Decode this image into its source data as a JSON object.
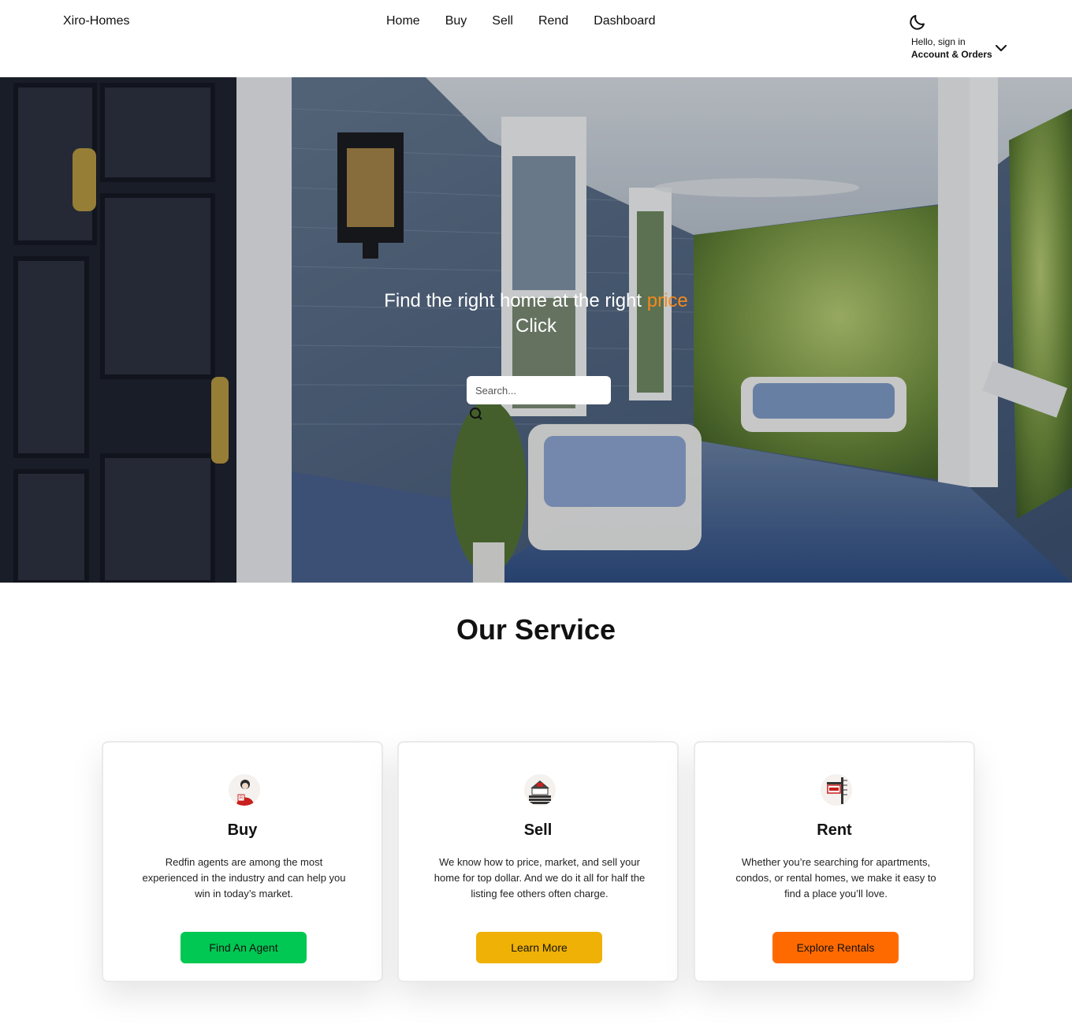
{
  "header": {
    "brand": "Xiro-Homes",
    "nav": [
      "Home",
      "Buy",
      "Sell",
      "Rend",
      "Dashboard"
    ],
    "theme_icon": "moon-icon",
    "account_greeting": "Hello, sign in",
    "account_label": "Account & Orders"
  },
  "hero": {
    "title_main": "Find the right home at the right ",
    "title_accent": "price",
    "title_line2": "Click",
    "search_placeholder": "Search...",
    "accent_color": "#f28a1c"
  },
  "service": {
    "title": "Our Service",
    "cards": [
      {
        "icon": "agent-icon",
        "title": "Buy",
        "text": "Redfin agents are among the most experienced in the industry and can help you win in today’s market.",
        "button": "Find An Agent",
        "button_color": "#00c853"
      },
      {
        "icon": "house-sale-icon",
        "title": "Sell",
        "text": "We know how to price, market, and sell your home for top dollar. And we do it all for half the listing fee others often charge.",
        "button": "Learn More",
        "button_color": "#efb106"
      },
      {
        "icon": "rent-sign-icon",
        "title": "Rent",
        "text": "Whether you’re searching for apartments, condos, or rental homes, we make it easy to find a place you’ll love.",
        "button": "Explore Rentals",
        "button_color": "#ff6a00"
      }
    ]
  }
}
